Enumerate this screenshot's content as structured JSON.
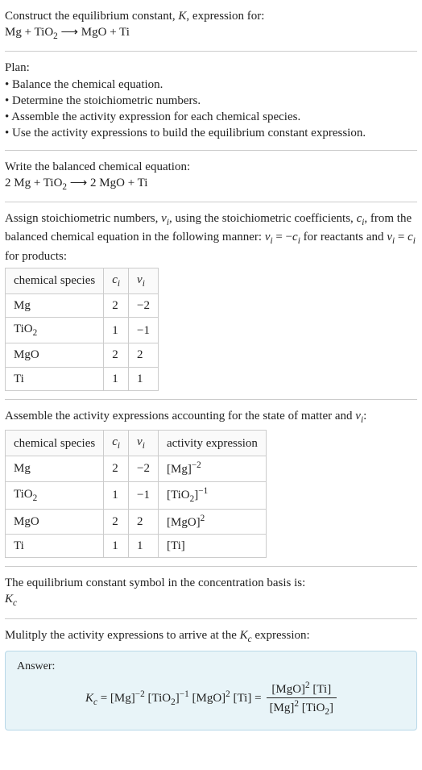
{
  "intro": {
    "line1_pre": "Construct the equilibrium constant, ",
    "K": "K",
    "line1_post": ", expression for:",
    "equation_lhs1": "Mg + TiO",
    "equation_sub1": "2",
    "equation_arrow": " ⟶ MgO + Ti"
  },
  "plan": {
    "title": "Plan:",
    "b1": "• Balance the chemical equation.",
    "b2": "• Determine the stoichiometric numbers.",
    "b3": "• Assemble the activity expression for each chemical species.",
    "b4": "• Use the activity expressions to build the equilibrium constant expression."
  },
  "balanced": {
    "title": "Write the balanced chemical equation:",
    "eq": "2 Mg + TiO",
    "sub": "2",
    "arrow": " ⟶ 2 MgO + Ti"
  },
  "assign": {
    "text1": "Assign stoichiometric numbers, ",
    "nu": "ν",
    "i": "i",
    "text2": ", using the stoichiometric coefficients, ",
    "c": "c",
    "text3": ", from the balanced chemical equation in the following manner: ",
    "rel1a": " = −",
    "text4": " for reactants and ",
    "rel2a": " = ",
    "text5": " for products:"
  },
  "table1": {
    "h1": "chemical species",
    "h2": "c",
    "h3": "ν",
    "sub_i": "i",
    "rows": [
      {
        "sp": "Mg",
        "c": "2",
        "n": "−2"
      },
      {
        "sp": "TiO",
        "sp_sub": "2",
        "c": "1",
        "n": "−1"
      },
      {
        "sp": "MgO",
        "c": "2",
        "n": "2"
      },
      {
        "sp": "Ti",
        "c": "1",
        "n": "1"
      }
    ]
  },
  "assemble": {
    "text1": "Assemble the activity expressions accounting for the state of matter and ",
    "text2": ":"
  },
  "table2": {
    "h1": "chemical species",
    "h2": "c",
    "h3": "ν",
    "h4": "activity expression",
    "sub_i": "i",
    "rows": [
      {
        "sp": "Mg",
        "c": "2",
        "n": "−2",
        "a": "[Mg]",
        "a_sup": "−2"
      },
      {
        "sp": "TiO",
        "sp_sub": "2",
        "c": "1",
        "n": "−1",
        "a": "[TiO",
        "a_sub": "2",
        "a_close": "]",
        "a_sup": "−1"
      },
      {
        "sp": "MgO",
        "c": "2",
        "n": "2",
        "a": "[MgO]",
        "a_sup": "2"
      },
      {
        "sp": "Ti",
        "c": "1",
        "n": "1",
        "a": "[Ti]"
      }
    ]
  },
  "symbol": {
    "text": "The equilibrium constant symbol in the concentration basis is:",
    "K": "K",
    "c": "c"
  },
  "multiply": {
    "text1": "Mulitply the activity expressions to arrive at the ",
    "K": "K",
    "c": "c",
    "text2": " expression:"
  },
  "answer": {
    "label": "Answer:",
    "K": "K",
    "c": "c",
    "eq": " = [Mg]",
    "s1": "−2",
    "p2": " [TiO",
    "p2sub": "2",
    "p2close": "]",
    "s2": "−1",
    "p3": " [MgO]",
    "s3": "2",
    "p4": " [Ti] = ",
    "num_a": "[MgO]",
    "num_asup": "2",
    "num_b": " [Ti]",
    "den_a": "[Mg]",
    "den_asup": "2",
    "den_b": " [TiO",
    "den_bsub": "2",
    "den_bclose": "]"
  }
}
